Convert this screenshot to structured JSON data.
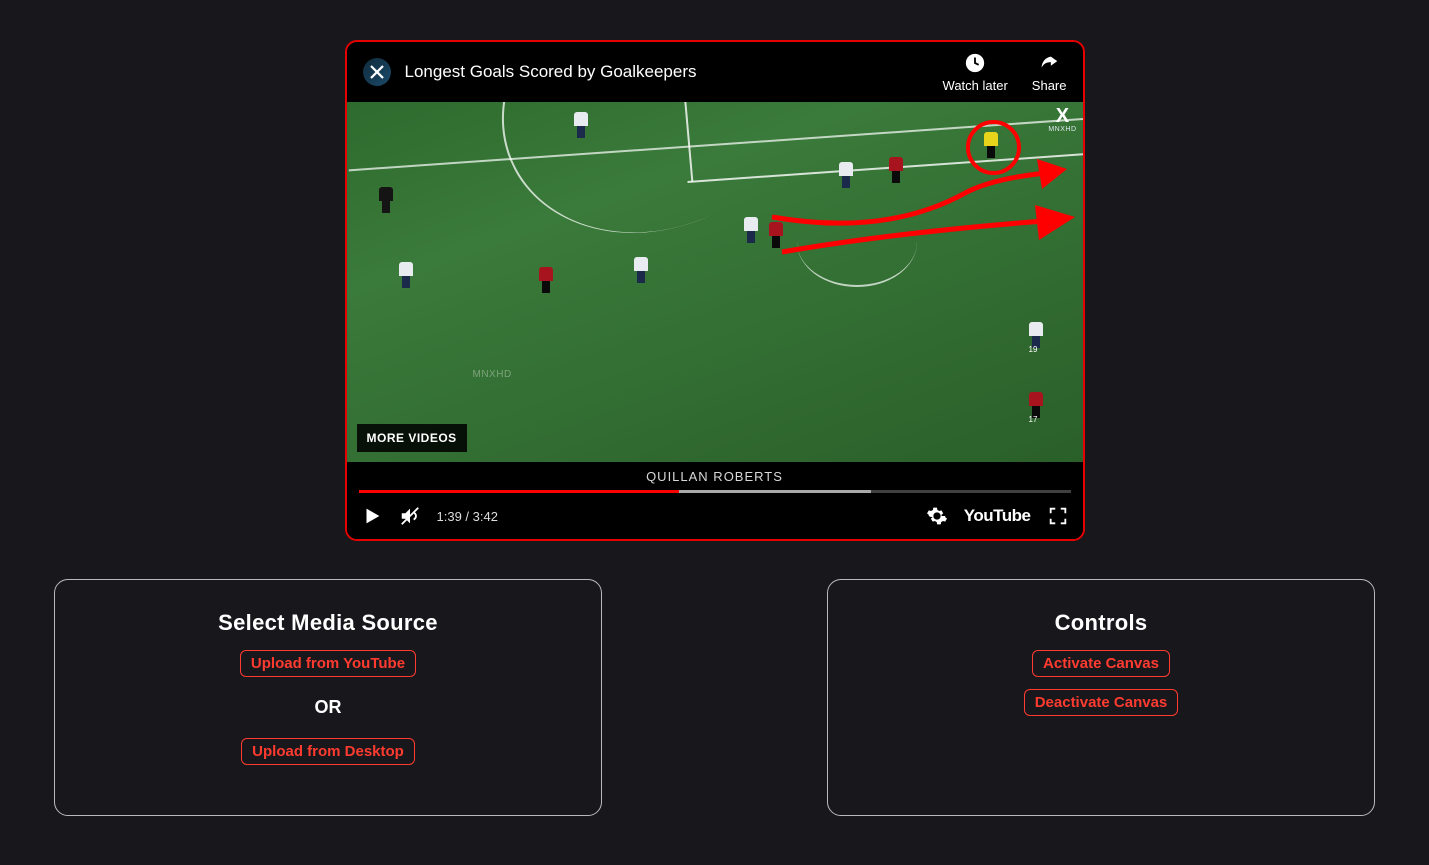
{
  "video": {
    "title": "Longest Goals Scored by Goalkeepers",
    "watch_later": "Watch later",
    "share": "Share",
    "more_videos": "MORE VIDEOS",
    "caption": "QUILLAN ROBERTS",
    "watermark": "MNXHD",
    "corner_logo": "MNXHD",
    "time_current": "1:39",
    "time_total": "3:42",
    "progress_played_pct": 45,
    "progress_loaded_pct": 72,
    "youtube_label": "YouTube"
  },
  "panels": {
    "media": {
      "title": "Select Media Source",
      "upload_youtube": "Upload from YouTube",
      "or": "OR",
      "upload_desktop": "Upload from Desktop"
    },
    "controls": {
      "title": "Controls",
      "activate": "Activate Canvas",
      "deactivate": "Deactivate Canvas"
    }
  }
}
